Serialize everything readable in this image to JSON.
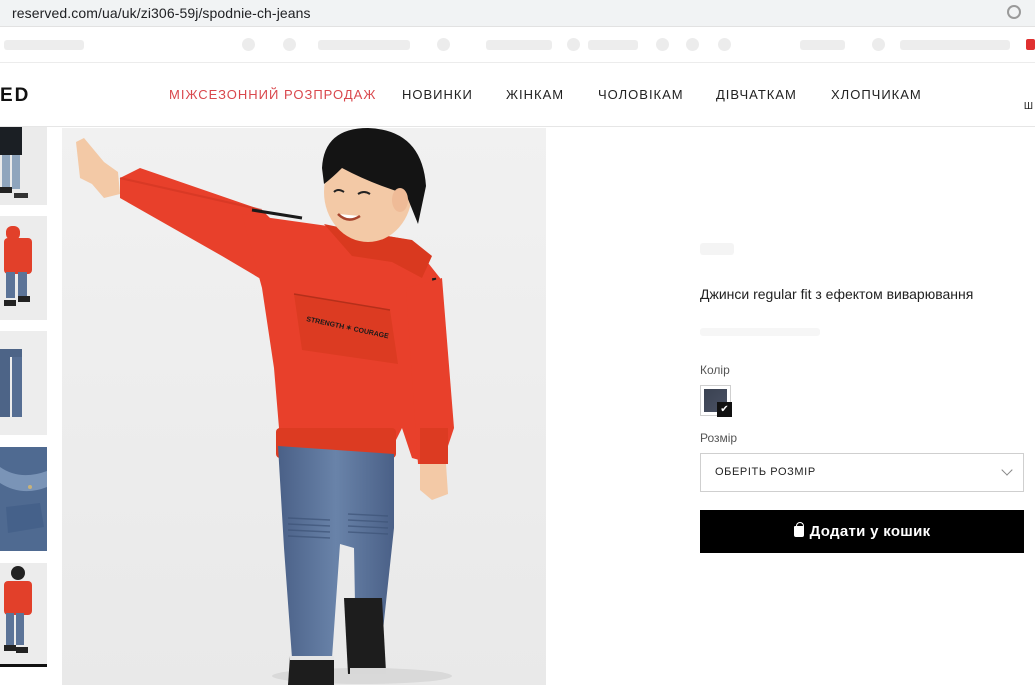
{
  "browser": {
    "url": "reserved.com/ua/uk/zi306-59j/spodnie-ch-jeans"
  },
  "header": {
    "logo_text": "ED",
    "edge_text": "Ш",
    "nav": [
      {
        "label": "МІЖСЕЗОННИЙ РОЗПРОДАЖ"
      },
      {
        "label": "НОВИНКИ"
      },
      {
        "label": "ЖІНКАМ"
      },
      {
        "label": "ЧОЛОВІКАМ"
      },
      {
        "label": "ДІВЧАТКАМ"
      },
      {
        "label": "ХЛОПЧИКАМ"
      }
    ]
  },
  "colors": {
    "sale": "#d9474c",
    "sweatshirt": "#e8402b",
    "jeans": "#4d6487",
    "button": "#000000"
  },
  "product": {
    "name": "Джинси regular fit з ефектом виварювання",
    "color_label": "Колір",
    "size_label": "Розмір",
    "size_placeholder": "ОБЕРІТЬ РОЗМІР",
    "add_to_cart": "Додати у кошик",
    "print_text": "STRENGTH ✶ COURAGE"
  },
  "icons": {
    "bag": "shopping-bag-icon",
    "chevron": "chevron-down-icon",
    "check": "check-icon"
  }
}
